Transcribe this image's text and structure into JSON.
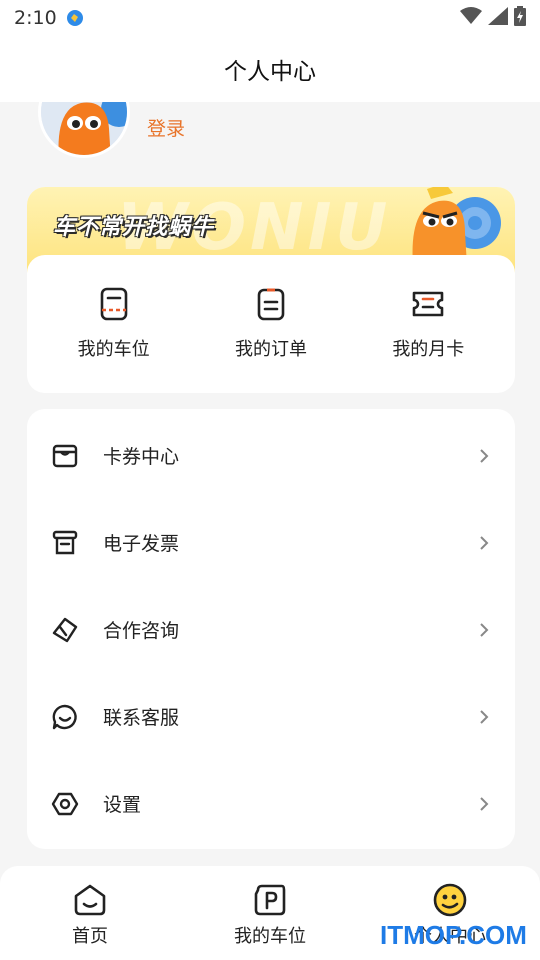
{
  "status_bar": {
    "time": "2:10"
  },
  "header": {
    "title": "个人中心"
  },
  "profile": {
    "login_label": "登录"
  },
  "promo": {
    "slogan": "车不常开找蜗牛",
    "watermark_text": "WONIU"
  },
  "quick_actions": [
    {
      "label": "我的车位",
      "icon": "parking-card-icon"
    },
    {
      "label": "我的订单",
      "icon": "order-list-icon"
    },
    {
      "label": "我的月卡",
      "icon": "monthly-ticket-icon"
    }
  ],
  "menu": [
    {
      "label": "卡券中心",
      "icon": "coupon-icon"
    },
    {
      "label": "电子发票",
      "icon": "invoice-icon"
    },
    {
      "label": "合作咨询",
      "icon": "handshake-icon"
    },
    {
      "label": "联系客服",
      "icon": "customer-service-icon"
    },
    {
      "label": "设置",
      "icon": "settings-icon"
    }
  ],
  "tab_bar": [
    {
      "label": "首页",
      "icon": "home-icon"
    },
    {
      "label": "我的车位",
      "icon": "parking-icon"
    },
    {
      "label": "个人中心",
      "icon": "profile-smiley-icon",
      "active": true
    }
  ],
  "watermark": "ITMOP.COM",
  "colors": {
    "accent": "#e8742a",
    "banner_yellow": "#fee37d",
    "background": "#f5f5f5",
    "watermark_blue": "#1e7be6"
  }
}
